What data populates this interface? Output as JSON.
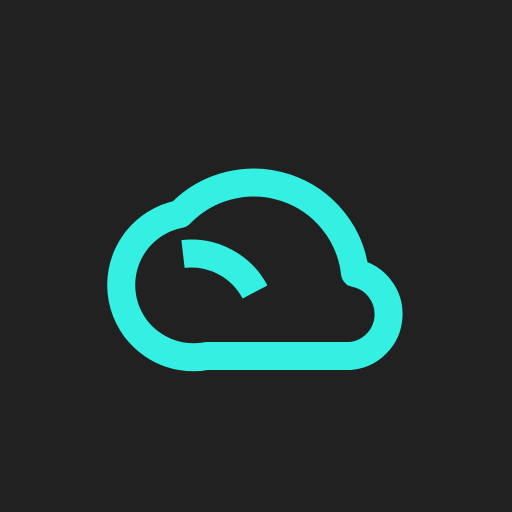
{
  "icon": {
    "name": "cloud-icon",
    "stroke_color": "#33F0E2",
    "background_color": "#212121"
  }
}
